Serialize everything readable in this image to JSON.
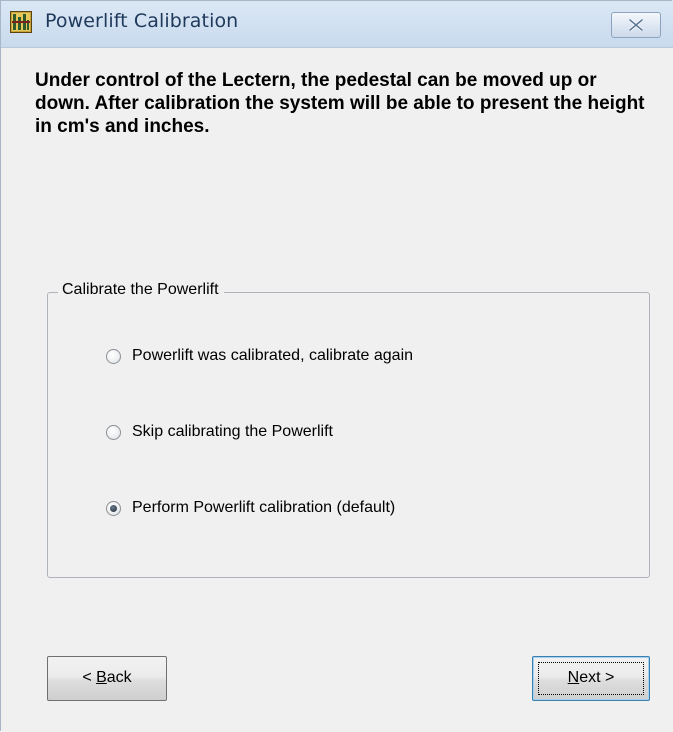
{
  "window": {
    "title": "Powerlift Calibration",
    "icon": "powerlift-app-icon",
    "close_icon": "close-icon"
  },
  "intro_text": "Under control of the Lectern, the pedestal can be moved up or down. After calibration the system will be able to present the height in cm's and inches.",
  "group": {
    "label": "Calibrate the Powerlift",
    "options": [
      {
        "label": "Powerlift was calibrated, calibrate again",
        "selected": false
      },
      {
        "label": "Skip calibrating the Powerlift",
        "selected": false
      },
      {
        "label": "Perform Powerlift calibration (default)",
        "selected": true
      }
    ]
  },
  "buttons": {
    "back": {
      "prefix": "< ",
      "accel": "B",
      "rest": "ack"
    },
    "next": {
      "prefix": "",
      "accel": "N",
      "rest": "ext >"
    }
  },
  "colors": {
    "titlebar": "#d2e1f1",
    "dialog_bg": "#f0f0f0",
    "title_text": "#1e395b",
    "default_button_border": "#3c7fb1"
  }
}
